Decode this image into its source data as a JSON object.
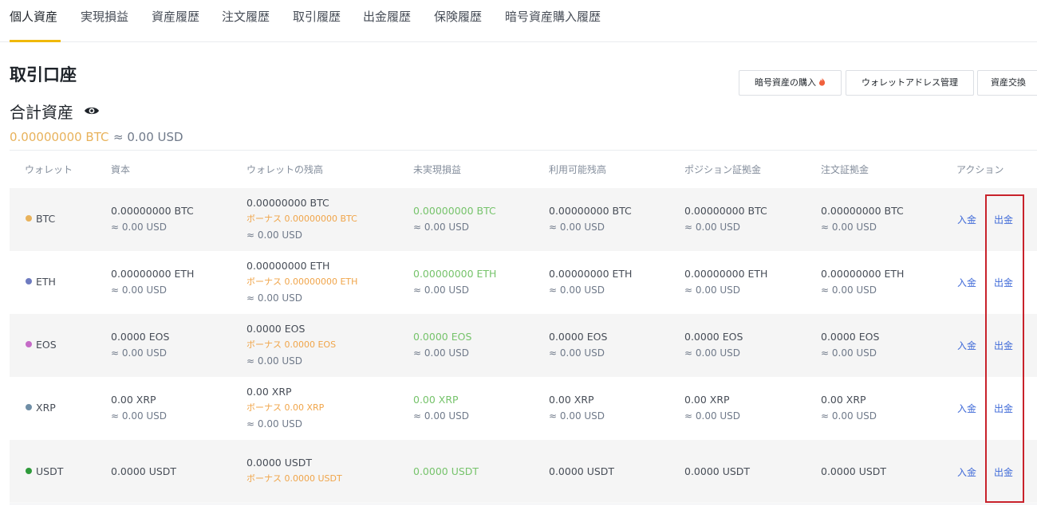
{
  "tabs": [
    "個人資産",
    "実現損益",
    "資産履歴",
    "注文履歴",
    "取引履歴",
    "出金履歴",
    "保険履歴",
    "暗号資産購入履歴"
  ],
  "header": {
    "title": "取引口座",
    "total_label": "合計資産",
    "total_btc": "0.00000000 BTC",
    "total_usd": "≈ 0.00 USD"
  },
  "buttons": {
    "buy": "暗号資産の購入",
    "wallet_address": "ウォレットアドレス管理",
    "convert": "資産交換"
  },
  "table": {
    "headers": [
      "ウォレット",
      "資本",
      "ウォレットの残高",
      "未実現損益",
      "利用可能残高",
      "ポジション証拠金",
      "注文証拠金",
      "アクション"
    ],
    "rows": [
      {
        "coin": "BTC",
        "dot_color": "#e8b25b",
        "capital": "0.00000000 BTC",
        "capital_usd": "≈ 0.00 USD",
        "balance": "0.00000000 BTC",
        "bonus": "ボーナス 0.00000000 BTC",
        "balance_usd": "≈ 0.00 USD",
        "unrealized": "0.00000000 BTC",
        "unrealized_usd": "≈ 0.00 USD",
        "available": "0.00000000 BTC",
        "available_usd": "≈ 0.00 USD",
        "position_margin": "0.00000000 BTC",
        "position_margin_usd": "≈ 0.00 USD",
        "order_margin": "0.00000000 BTC",
        "order_margin_usd": "≈ 0.00 USD",
        "deposit": "入金",
        "withdraw": "出金"
      },
      {
        "coin": "ETH",
        "dot_color": "#6e7bc0",
        "capital": "0.00000000 ETH",
        "capital_usd": "≈ 0.00 USD",
        "balance": "0.00000000 ETH",
        "bonus": "ボーナス 0.00000000 ETH",
        "balance_usd": "≈ 0.00 USD",
        "unrealized": "0.00000000 ETH",
        "unrealized_usd": "≈ 0.00 USD",
        "available": "0.00000000 ETH",
        "available_usd": "≈ 0.00 USD",
        "position_margin": "0.00000000 ETH",
        "position_margin_usd": "≈ 0.00 USD",
        "order_margin": "0.00000000 ETH",
        "order_margin_usd": "≈ 0.00 USD",
        "deposit": "入金",
        "withdraw": "出金"
      },
      {
        "coin": "EOS",
        "dot_color": "#c56bc7",
        "capital": "0.0000 EOS",
        "capital_usd": "≈ 0.00 USD",
        "balance": "0.0000 EOS",
        "bonus": "ボーナス 0.0000 EOS",
        "balance_usd": "≈ 0.00 USD",
        "unrealized": "0.0000 EOS",
        "unrealized_usd": "≈ 0.00 USD",
        "available": "0.0000 EOS",
        "available_usd": "≈ 0.00 USD",
        "position_margin": "0.0000 EOS",
        "position_margin_usd": "≈ 0.00 USD",
        "order_margin": "0.0000 EOS",
        "order_margin_usd": "≈ 0.00 USD",
        "deposit": "入金",
        "withdraw": "出金"
      },
      {
        "coin": "XRP",
        "dot_color": "#6f8ea6",
        "capital": "0.00 XRP",
        "capital_usd": "≈ 0.00 USD",
        "balance": "0.00 XRP",
        "bonus": "ボーナス 0.00 XRP",
        "balance_usd": "≈ 0.00 USD",
        "unrealized": "0.00 XRP",
        "unrealized_usd": "≈ 0.00 USD",
        "available": "0.00 XRP",
        "available_usd": "≈ 0.00 USD",
        "position_margin": "0.00 XRP",
        "position_margin_usd": "≈ 0.00 USD",
        "order_margin": "0.00 XRP",
        "order_margin_usd": "≈ 0.00 USD",
        "deposit": "入金",
        "withdraw": "出金"
      },
      {
        "coin": "USDT",
        "dot_color": "#2e9a3a",
        "capital": "0.0000 USDT",
        "balance": "0.0000 USDT",
        "bonus": "ボーナス 0.0000 USDT",
        "unrealized": "0.0000 USDT",
        "available": "0.0000 USDT",
        "position_margin": "0.0000 USDT",
        "order_margin": "0.0000 USDT",
        "deposit": "入金",
        "withdraw": "出金"
      }
    ]
  }
}
